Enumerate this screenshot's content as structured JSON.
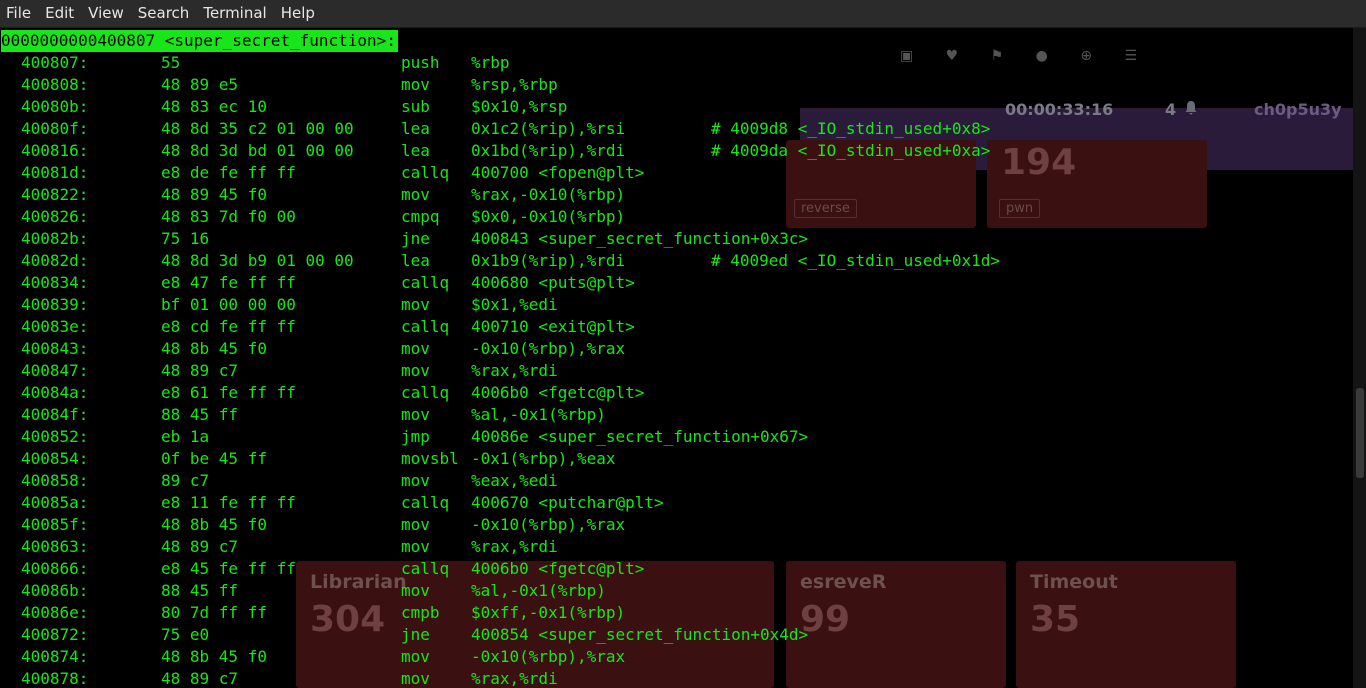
{
  "menu": [
    "File",
    "Edit",
    "View",
    "Search",
    "Terminal",
    "Help"
  ],
  "background": {
    "timer": "00:00:33:16",
    "notifications": "4",
    "username": "ch0p5u3y",
    "cards": [
      {
        "title": "",
        "value": "194",
        "tag": "pwn"
      },
      {
        "title": "Librarian",
        "value": "304",
        "tag": ""
      },
      {
        "title": "esreveR",
        "value": "99",
        "tag": ""
      },
      {
        "title": "Timeout",
        "value": "35",
        "tag": ""
      }
    ],
    "card_tag_reverse": "reverse"
  },
  "terminal": {
    "heading": "0000000000400807 <super_secret_function>:",
    "rows": [
      {
        "addr": "400807:",
        "bytes": "55",
        "mnemonic": "push",
        "operands": "%rbp",
        "comment": ""
      },
      {
        "addr": "400808:",
        "bytes": "48 89 e5",
        "mnemonic": "mov",
        "operands": "%rsp,%rbp",
        "comment": ""
      },
      {
        "addr": "40080b:",
        "bytes": "48 83 ec 10",
        "mnemonic": "sub",
        "operands": "$0x10,%rsp",
        "comment": ""
      },
      {
        "addr": "40080f:",
        "bytes": "48 8d 35 c2 01 00 00",
        "mnemonic": "lea",
        "operands": "0x1c2(%rip),%rsi",
        "comment": "# 4009d8 <_IO_stdin_used+0x8>"
      },
      {
        "addr": "400816:",
        "bytes": "48 8d 3d bd 01 00 00",
        "mnemonic": "lea",
        "operands": "0x1bd(%rip),%rdi",
        "comment": "# 4009da <_IO_stdin_used+0xa>"
      },
      {
        "addr": "40081d:",
        "bytes": "e8 de fe ff ff",
        "mnemonic": "callq",
        "operands": "400700 <fopen@plt>",
        "comment": ""
      },
      {
        "addr": "400822:",
        "bytes": "48 89 45 f0",
        "mnemonic": "mov",
        "operands": "%rax,-0x10(%rbp)",
        "comment": ""
      },
      {
        "addr": "400826:",
        "bytes": "48 83 7d f0 00",
        "mnemonic": "cmpq",
        "operands": "$0x0,-0x10(%rbp)",
        "comment": ""
      },
      {
        "addr": "40082b:",
        "bytes": "75 16",
        "mnemonic": "jne",
        "operands": "400843 <super_secret_function+0x3c>",
        "comment": ""
      },
      {
        "addr": "40082d:",
        "bytes": "48 8d 3d b9 01 00 00",
        "mnemonic": "lea",
        "operands": "0x1b9(%rip),%rdi",
        "comment": "# 4009ed <_IO_stdin_used+0x1d>"
      },
      {
        "addr": "400834:",
        "bytes": "e8 47 fe ff ff",
        "mnemonic": "callq",
        "operands": "400680 <puts@plt>",
        "comment": ""
      },
      {
        "addr": "400839:",
        "bytes": "bf 01 00 00 00",
        "mnemonic": "mov",
        "operands": "$0x1,%edi",
        "comment": ""
      },
      {
        "addr": "40083e:",
        "bytes": "e8 cd fe ff ff",
        "mnemonic": "callq",
        "operands": "400710 <exit@plt>",
        "comment": ""
      },
      {
        "addr": "400843:",
        "bytes": "48 8b 45 f0",
        "mnemonic": "mov",
        "operands": "-0x10(%rbp),%rax",
        "comment": ""
      },
      {
        "addr": "400847:",
        "bytes": "48 89 c7",
        "mnemonic": "mov",
        "operands": "%rax,%rdi",
        "comment": ""
      },
      {
        "addr": "40084a:",
        "bytes": "e8 61 fe ff ff",
        "mnemonic": "callq",
        "operands": "4006b0 <fgetc@plt>",
        "comment": ""
      },
      {
        "addr": "40084f:",
        "bytes": "88 45 ff",
        "mnemonic": "mov",
        "operands": "%al,-0x1(%rbp)",
        "comment": ""
      },
      {
        "addr": "400852:",
        "bytes": "eb 1a",
        "mnemonic": "jmp",
        "operands": "40086e <super_secret_function+0x67>",
        "comment": ""
      },
      {
        "addr": "400854:",
        "bytes": "0f be 45 ff",
        "mnemonic": "movsbl",
        "operands": "-0x1(%rbp),%eax",
        "comment": ""
      },
      {
        "addr": "400858:",
        "bytes": "89 c7",
        "mnemonic": "mov",
        "operands": "%eax,%edi",
        "comment": ""
      },
      {
        "addr": "40085a:",
        "bytes": "e8 11 fe ff ff",
        "mnemonic": "callq",
        "operands": "400670 <putchar@plt>",
        "comment": ""
      },
      {
        "addr": "40085f:",
        "bytes": "48 8b 45 f0",
        "mnemonic": "mov",
        "operands": "-0x10(%rbp),%rax",
        "comment": ""
      },
      {
        "addr": "400863:",
        "bytes": "48 89 c7",
        "mnemonic": "mov",
        "operands": "%rax,%rdi",
        "comment": ""
      },
      {
        "addr": "400866:",
        "bytes": "e8 45 fe ff ff",
        "mnemonic": "callq",
        "operands": "4006b0 <fgetc@plt>",
        "comment": ""
      },
      {
        "addr": "40086b:",
        "bytes": "88 45 ff",
        "mnemonic": "mov",
        "operands": "%al,-0x1(%rbp)",
        "comment": ""
      },
      {
        "addr": "40086e:",
        "bytes": "80 7d ff ff",
        "mnemonic": "cmpb",
        "operands": "$0xff,-0x1(%rbp)",
        "comment": ""
      },
      {
        "addr": "400872:",
        "bytes": "75 e0",
        "mnemonic": "jne",
        "operands": "400854 <super_secret_function+0x4d>",
        "comment": ""
      },
      {
        "addr": "400874:",
        "bytes": "48 8b 45 f0",
        "mnemonic": "mov",
        "operands": "-0x10(%rbp),%rax",
        "comment": ""
      },
      {
        "addr": "400878:",
        "bytes": "48 89 c7",
        "mnemonic": "mov",
        "operands": "%rax,%rdi",
        "comment": ""
      }
    ]
  },
  "colors": {
    "terminal_fg": "#19e619",
    "terminal_bg": "#000000",
    "menubar_bg": "#2b2b2b"
  }
}
